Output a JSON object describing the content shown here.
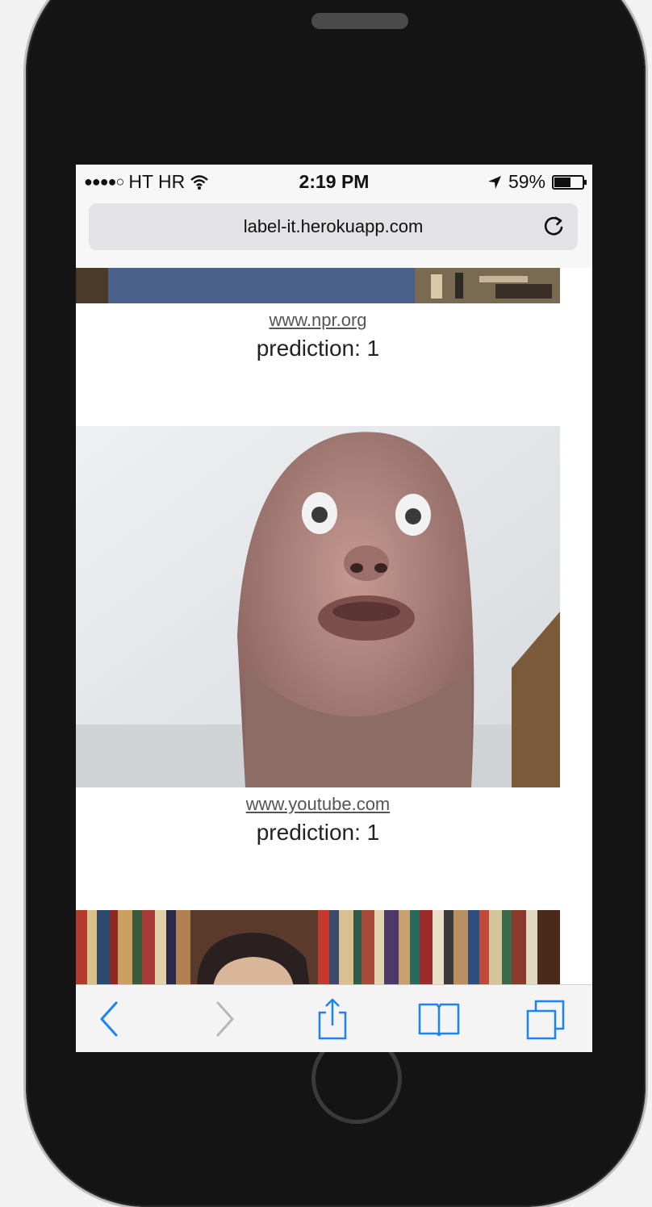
{
  "status_bar": {
    "carrier": "HT HR",
    "time": "2:19 PM",
    "battery_percent": "59%",
    "battery_level": 0.59,
    "signal_dots": "●●●●○"
  },
  "browser": {
    "url": "label-it.herokuapp.com",
    "reload_icon": "reload-icon"
  },
  "results": [
    {
      "source": "www.npr.org",
      "prediction": "prediction: 1"
    },
    {
      "source": "www.youtube.com",
      "prediction": "prediction: 1"
    }
  ],
  "toolbar": {
    "back_icon": "chevron-left-icon",
    "forward_icon": "chevron-right-icon",
    "share_icon": "share-icon",
    "bookmarks_icon": "book-icon",
    "tabs_icon": "tabs-icon"
  },
  "colors": {
    "ios_blue": "#1a82fb",
    "disabled_gray": "#b8b8b8",
    "phone_body": "#141414"
  }
}
